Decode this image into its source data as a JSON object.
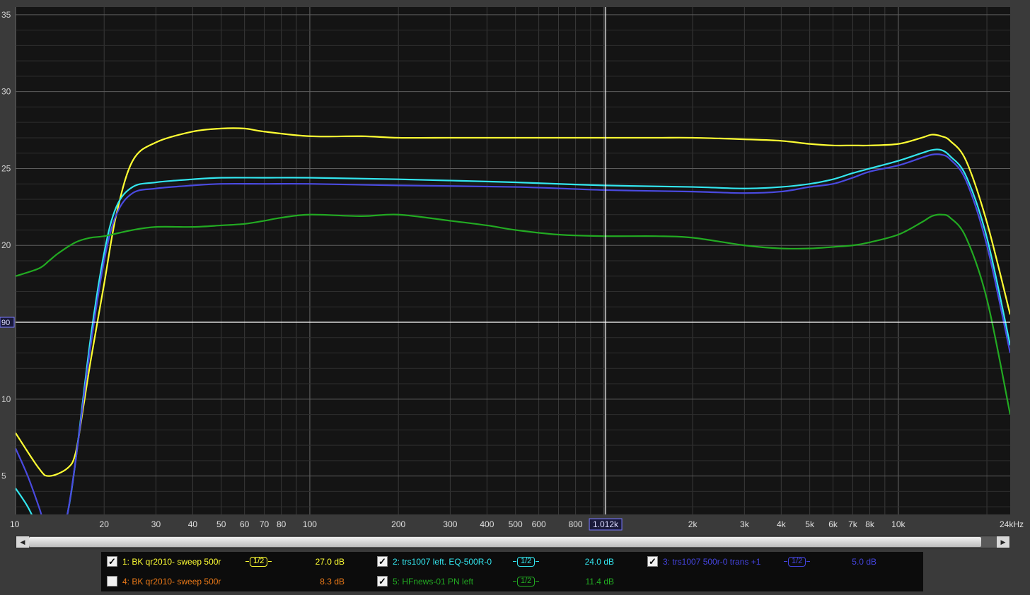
{
  "chart_data": {
    "type": "line",
    "x_scale": "log",
    "xlim": [
      10,
      24000
    ],
    "ylim": [
      2.5,
      35.5
    ],
    "grid": true,
    "y_ticks": [
      {
        "v": 35,
        "label": "35"
      },
      {
        "v": 30,
        "label": "30"
      },
      {
        "v": 25,
        "label": "25"
      },
      {
        "v": 20,
        "label": "20"
      },
      {
        "v": 15,
        "label": "90"
      },
      {
        "v": 10,
        "label": "10"
      },
      {
        "v": 5,
        "label": "5"
      }
    ],
    "x_ticks": [
      {
        "v": 10,
        "label": "10"
      },
      {
        "v": 20,
        "label": "20"
      },
      {
        "v": 30,
        "label": "30"
      },
      {
        "v": 40,
        "label": "40"
      },
      {
        "v": 50,
        "label": "50"
      },
      {
        "v": 60,
        "label": "60"
      },
      {
        "v": 70,
        "label": "70"
      },
      {
        "v": 80,
        "label": "80"
      },
      {
        "v": 100,
        "label": "100"
      },
      {
        "v": 200,
        "label": "200"
      },
      {
        "v": 300,
        "label": "300"
      },
      {
        "v": 400,
        "label": "400"
      },
      {
        "v": 500,
        "label": "500"
      },
      {
        "v": 600,
        "label": "600"
      },
      {
        "v": 800,
        "label": "800"
      },
      {
        "v": 2000,
        "label": "2k"
      },
      {
        "v": 3000,
        "label": "3k"
      },
      {
        "v": 4000,
        "label": "4k"
      },
      {
        "v": 5000,
        "label": "5k"
      },
      {
        "v": 6000,
        "label": "6k"
      },
      {
        "v": 7000,
        "label": "7k"
      },
      {
        "v": 8000,
        "label": "8k"
      },
      {
        "v": 10000,
        "label": "10k"
      },
      {
        "v": 24000,
        "label": "24kHz"
      }
    ],
    "cursor": {
      "x": 1012,
      "x_label": "1.012k",
      "y": 15,
      "y_label": "90"
    },
    "series": [
      {
        "name": "1: BK qr2010- sweep 500r",
        "color": "#ffff33",
        "x": [
          10,
          12,
          13,
          15,
          16,
          17,
          18,
          20,
          22,
          25,
          30,
          40,
          50,
          60,
          70,
          100,
          150,
          200,
          300,
          400,
          500,
          1000,
          1500,
          2000,
          3000,
          4000,
          5000,
          6000,
          7000,
          8000,
          10000,
          12000,
          13000,
          14000,
          15000,
          17000,
          20000,
          24000
        ],
        "y": [
          7.8,
          5.5,
          5.0,
          5.5,
          6.5,
          9.5,
          12.5,
          17.5,
          22.0,
          25.5,
          26.7,
          27.4,
          27.6,
          27.6,
          27.4,
          27.1,
          27.1,
          27.0,
          27.0,
          27.0,
          27.0,
          27.0,
          27.0,
          27.0,
          26.9,
          26.8,
          26.6,
          26.5,
          26.5,
          26.5,
          26.6,
          27.0,
          27.2,
          27.1,
          26.8,
          25.5,
          21.5,
          15.5
        ]
      },
      {
        "name": "2: trs1007 left. EQ-500R-0",
        "color": "#33e6ef",
        "x": [
          10,
          11,
          12,
          13,
          14,
          15,
          16,
          18,
          20,
          22,
          25,
          30,
          40,
          50,
          70,
          100,
          200,
          500,
          1000,
          2000,
          3000,
          4000,
          5000,
          6000,
          7000,
          8000,
          10000,
          12000,
          13000,
          14000,
          15000,
          17000,
          20000,
          24000
        ],
        "y": [
          4.2,
          3.0,
          1.5,
          0.0,
          0.5,
          2.5,
          6.0,
          14.0,
          19.5,
          22.5,
          23.8,
          24.1,
          24.3,
          24.4,
          24.4,
          24.4,
          24.3,
          24.1,
          23.9,
          23.8,
          23.7,
          23.8,
          24.0,
          24.3,
          24.7,
          25.0,
          25.5,
          26.0,
          26.2,
          26.2,
          25.8,
          24.5,
          20.5,
          13.5
        ]
      },
      {
        "name": "3: trs1007 500r-0 trans +1",
        "color": "#4a4ae0",
        "x": [
          10,
          11,
          12,
          13,
          14,
          15,
          16,
          18,
          20,
          22,
          25,
          30,
          40,
          50,
          70,
          100,
          200,
          500,
          1000,
          2000,
          3000,
          4000,
          5000,
          6000,
          7000,
          8000,
          10000,
          12000,
          13000,
          14000,
          15000,
          17000,
          20000,
          24000
        ],
        "y": [
          6.8,
          5.0,
          3.0,
          1.0,
          0.5,
          2.5,
          6.0,
          13.5,
          19.0,
          22.0,
          23.4,
          23.7,
          23.9,
          24.0,
          24.0,
          24.0,
          23.9,
          23.8,
          23.6,
          23.5,
          23.4,
          23.5,
          23.8,
          24.0,
          24.4,
          24.8,
          25.2,
          25.7,
          25.9,
          25.9,
          25.6,
          24.2,
          20.0,
          13.0
        ]
      },
      {
        "name": "5: HFnews-01 PN left",
        "color": "#22aa22",
        "x": [
          10,
          12,
          13,
          14,
          16,
          18,
          20,
          25,
          30,
          40,
          50,
          60,
          70,
          80,
          100,
          150,
          200,
          300,
          400,
          500,
          700,
          1000,
          1500,
          2000,
          3000,
          4000,
          5000,
          6000,
          7000,
          8000,
          10000,
          12000,
          13000,
          14000,
          15000,
          17000,
          20000,
          24000
        ],
        "y": [
          18.0,
          18.5,
          19.0,
          19.5,
          20.2,
          20.5,
          20.6,
          21.0,
          21.2,
          21.2,
          21.3,
          21.4,
          21.6,
          21.8,
          22.0,
          21.9,
          22.0,
          21.6,
          21.3,
          21.0,
          20.7,
          20.6,
          20.6,
          20.5,
          20.0,
          19.8,
          19.8,
          19.9,
          20.0,
          20.2,
          20.7,
          21.5,
          21.9,
          22.0,
          21.8,
          20.5,
          16.5,
          9.0
        ]
      }
    ]
  },
  "scrollbar": {
    "left_arrow": "◀",
    "right_arrow": "▶"
  },
  "legend": {
    "check_mark": "✓",
    "smoothing": "1/2",
    "items": [
      {
        "label": "1: BK qr2010- sweep 500r",
        "value": "27.0 dB",
        "color": "#ffff33",
        "checked": true,
        "show_smoothing": true
      },
      {
        "label": "2: trs1007 left. EQ-500R-0",
        "value": "24.0 dB",
        "color": "#33e6ef",
        "checked": true,
        "show_smoothing": true
      },
      {
        "label": "3: trs1007 500r-0 trans +1",
        "value": "5.0 dB",
        "color": "#4444dd",
        "checked": true,
        "show_smoothing": true
      },
      {
        "label": "4: BK qr2010- sweep 500r",
        "value": "8.3 dB",
        "color": "#e87818",
        "checked": false,
        "show_smoothing": false
      },
      {
        "label": "5: HFnews-01 PN left",
        "value": "11.4 dB",
        "color": "#22aa22",
        "checked": true,
        "show_smoothing": true
      }
    ]
  }
}
